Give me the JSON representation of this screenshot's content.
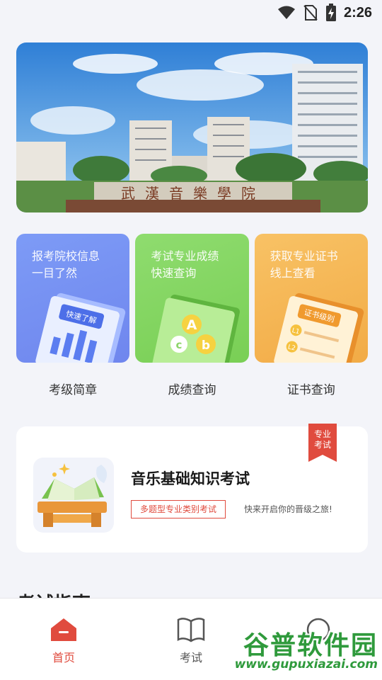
{
  "status_bar": {
    "time": "2:26"
  },
  "banner": {
    "sign_text": "武漢音樂學院"
  },
  "cards": [
    {
      "line1": "报考院校信息",
      "line2": "一目了然",
      "art_text": "快速了解",
      "label": "考级简章",
      "color": "#7d9bf6"
    },
    {
      "line1": "考试专业成绩",
      "line2": "快速查询",
      "art_text": "",
      "label": "成绩查询",
      "color": "#8fdc6f"
    },
    {
      "line1": "获取专业证书",
      "line2": "线上查看",
      "art_text": "证书级别",
      "label": "证书查询",
      "color": "#f8c265"
    }
  ],
  "exam": {
    "ribbon": "专业考试",
    "title": "音乐基础知识考试",
    "tag": "多题型专业类别考试",
    "subtitle": "快来开启你的晋级之旅!"
  },
  "guide": {
    "title": "考试指南"
  },
  "tabbar": {
    "items": [
      {
        "label": "首页",
        "active": true
      },
      {
        "label": "考试",
        "active": false
      },
      {
        "label": "",
        "active": false
      }
    ]
  },
  "watermark": {
    "name": "谷普软件园",
    "url": "www.gupuxiazai.com"
  },
  "colors": {
    "accent": "#e04b3e",
    "background": "#f3f4f9"
  }
}
